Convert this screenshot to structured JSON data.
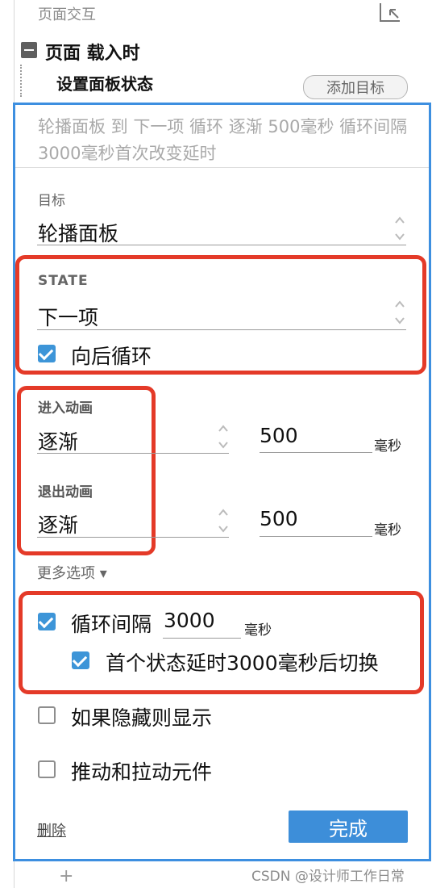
{
  "header": {
    "section_title": "页面交互",
    "corner_icon": "collapse-corner-icon",
    "event_title": "页面 载入时",
    "action_title": "设置面板状态",
    "add_target_label": "添加目标"
  },
  "panel": {
    "summary": "轮播面板 到 下一项 循环 逐渐 500毫秒 循环间隔3000毫秒首次改变延时",
    "target": {
      "label": "目标",
      "value": "轮播面板"
    },
    "state": {
      "label": "STATE",
      "value": "下一项",
      "wrap_label": "向后循环",
      "wrap_checked": true
    },
    "enter_animation": {
      "label": "进入动画",
      "value": "逐渐",
      "duration": "500",
      "unit": "毫秒"
    },
    "exit_animation": {
      "label": "退出动画",
      "value": "逐渐",
      "duration": "500",
      "unit": "毫秒"
    },
    "more_options_label": "更多选项 ▾",
    "loop": {
      "label": "循环间隔",
      "interval": "3000",
      "unit": "毫秒",
      "checked": true
    },
    "first_delay": {
      "label": "首个状态延时3000毫秒后切换",
      "checked": true
    },
    "show_if_hidden": {
      "label": "如果隐藏则显示",
      "checked": false
    },
    "push_pull": {
      "label": "推动和拉动元件",
      "checked": false
    },
    "delete_label": "删除",
    "done_label": "完成"
  },
  "footer": {
    "plus": "+",
    "watermark": "CSDN @设计师工作日常"
  },
  "colors": {
    "accent_blue": "#3d8fe0",
    "highlight_red": "#e43a28",
    "checkbox_blue": "#3d95d8"
  }
}
